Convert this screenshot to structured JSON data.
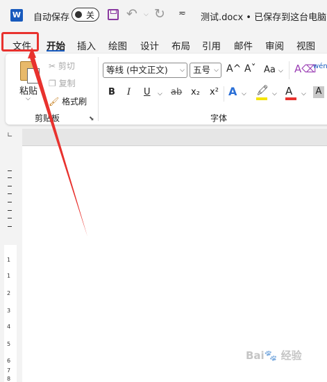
{
  "titlebar": {
    "app_icon_letter": "W",
    "autosave_label": "自动保存",
    "autosave_state": "关",
    "document_title": "测试.docx • 已保存到这台电脑 ∨"
  },
  "tabs": [
    "文件",
    "开始",
    "插入",
    "绘图",
    "设计",
    "布局",
    "引用",
    "邮件",
    "审阅",
    "视图"
  ],
  "ribbon": {
    "clipboard": {
      "paste_label": "粘贴",
      "cut_label": "剪切",
      "copy_label": "复制",
      "format_painter_label": "格式刷",
      "group_label": "剪贴板"
    },
    "font": {
      "font_name": "等线 (中文正文)",
      "font_size": "五号",
      "grow_font": "A^",
      "shrink_font": "Aˇ",
      "change_case": "Aa",
      "bold": "B",
      "italic": "I",
      "underline": "U",
      "strikethrough": "ab",
      "subscript": "x₂",
      "superscript": "x²",
      "text_effects": "A",
      "font_color": "A",
      "char_shading": "A",
      "phonetic_guide": "wén",
      "group_label": "字体"
    }
  },
  "colors": {
    "highlight_yellow": "#f5e400",
    "font_color_red": "#e8322e",
    "annotation_red": "#e8322e",
    "accent_blue": "#185abd"
  },
  "left_ruler_numbers": [
    "1",
    "1",
    "2",
    "3",
    "4",
    "5",
    "6",
    "7",
    "8"
  ]
}
